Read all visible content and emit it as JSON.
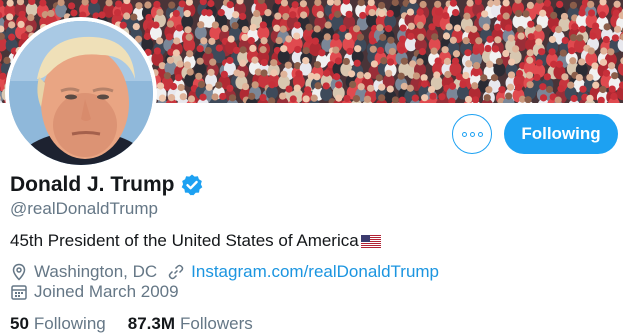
{
  "profile": {
    "name": "Donald J. Trump",
    "handle": "@realDonaldTrump",
    "bio": "45th President of the United States of America",
    "location": "Washington, DC",
    "website": "Instagram.com/realDonaldTrump",
    "joined": "Joined March 2009",
    "following_count": "50",
    "following_label": "Following",
    "followers_count": "87.3M",
    "followers_label": "Followers"
  },
  "actions": {
    "follow_label": "Following"
  },
  "icons": {
    "more": "more-options-icon",
    "verified": "verified-badge-icon",
    "flag": "us-flag-emoji",
    "location": "location-pin-icon",
    "link": "link-icon",
    "calendar": "calendar-icon"
  },
  "colors": {
    "accent": "#1da1f2",
    "link": "#1b95e0",
    "secondary_text": "#657786"
  }
}
